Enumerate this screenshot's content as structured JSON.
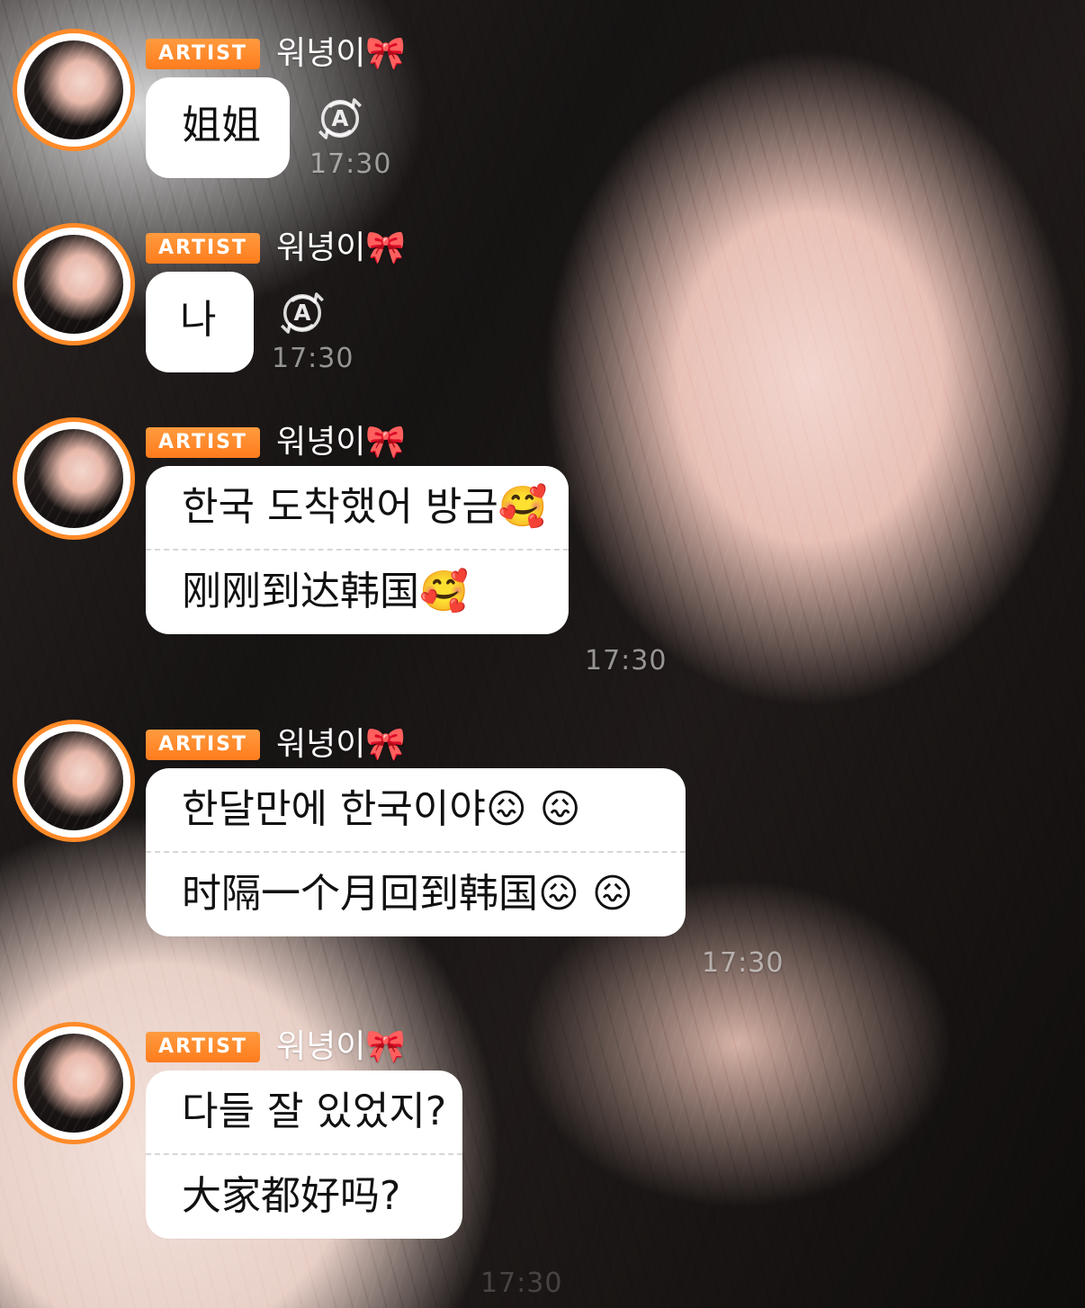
{
  "messages": [
    {
      "badge_label": "ARTIST",
      "sender_name": "워녕이🎀",
      "lines": [
        "姐姐"
      ],
      "timestamp": "17:30",
      "show_translate": true
    },
    {
      "badge_label": "ARTIST",
      "sender_name": "워녕이🎀",
      "lines": [
        "나"
      ],
      "timestamp": "17:30",
      "show_translate": true
    },
    {
      "badge_label": "ARTIST",
      "sender_name": "워녕이🎀",
      "lines": [
        "한국 도착했어 방금🥰",
        "刚刚到达韩国🥰"
      ],
      "timestamp": "17:30",
      "show_translate": false
    },
    {
      "badge_label": "ARTIST",
      "sender_name": "워녕이🎀",
      "lines": [
        "한달만에 한국이야😖 😖",
        "时隔一个月回到韩国😖 😖"
      ],
      "timestamp": "17:30",
      "show_translate": false
    },
    {
      "badge_label": "ARTIST",
      "sender_name": "워녕이🎀",
      "lines": [
        "다들 잘 있었지?",
        "大家都好吗?"
      ],
      "timestamp": "17:30",
      "show_translate": false
    }
  ],
  "icons": {
    "translate": "translate-icon",
    "bow": "bow-icon"
  },
  "colors": {
    "accent": "#ff8a28",
    "bubble_bg": "#ffffff",
    "text": "#111111",
    "timestamp": "rgba(255,255,255,0.55)"
  }
}
